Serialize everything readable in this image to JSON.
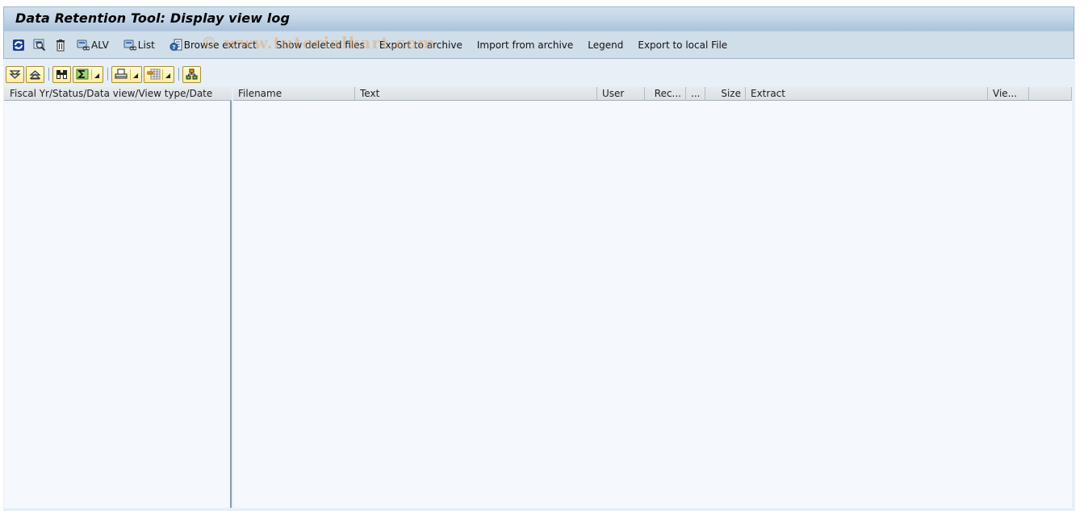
{
  "window": {
    "title": "Data Retention Tool: Display view log"
  },
  "app_toolbar": {
    "items": [
      {
        "id": "refresh",
        "icon": "refresh-icon",
        "label": ""
      },
      {
        "id": "display",
        "icon": "display-zoom-icon",
        "label": ""
      },
      {
        "id": "delete",
        "icon": "trash-icon",
        "label": ""
      },
      {
        "id": "alv",
        "icon": "database-view-icon",
        "label": "ALV"
      },
      {
        "id": "list",
        "icon": "database-view-icon",
        "label": "List"
      },
      {
        "id": "browse",
        "icon": "browse-extract-icon",
        "label": "Browse extract"
      },
      {
        "id": "show_deleted",
        "icon": "",
        "label": "Show deleted files"
      },
      {
        "id": "export_archive",
        "icon": "",
        "label": "Export to archive"
      },
      {
        "id": "import_archive",
        "icon": "",
        "label": "Import from archive"
      },
      {
        "id": "legend",
        "icon": "",
        "label": "Legend"
      },
      {
        "id": "export_local",
        "icon": "",
        "label": "Export to local File"
      }
    ]
  },
  "watermark": "© www.tutorialkart.com",
  "alv_toolbar": {
    "buttons": [
      {
        "id": "expand",
        "icon": "expand-all-icon"
      },
      {
        "id": "collapse",
        "icon": "collapse-all-icon"
      },
      {
        "id": "find",
        "icon": "binoculars-icon"
      },
      {
        "id": "sum",
        "icon": "sum-icon",
        "menu": true
      },
      {
        "id": "print",
        "icon": "print-icon",
        "menu": true
      },
      {
        "id": "layout",
        "icon": "layout-icon",
        "menu": true
      },
      {
        "id": "hierarchy",
        "icon": "hierarchy-icon"
      }
    ]
  },
  "tree": {
    "header": "Fiscal Yr/Status/Data view/View type/Date",
    "rows": []
  },
  "list": {
    "columns": [
      {
        "label": "Filename",
        "align": "left"
      },
      {
        "label": "Text",
        "align": "left"
      },
      {
        "label": "User",
        "align": "left"
      },
      {
        "label": "Rec...",
        "align": "right"
      },
      {
        "label": "...",
        "align": "left"
      },
      {
        "label": "Size",
        "align": "right"
      },
      {
        "label": "Extract",
        "align": "left"
      },
      {
        "label": "Vie...",
        "align": "left"
      },
      {
        "label": "",
        "align": "left"
      }
    ],
    "rows": []
  },
  "colors": {
    "title_gradient_top": "#d2e0ee",
    "title_gradient_bottom": "#a9c2db",
    "toolbar_bg": "#d0deea",
    "content_bg": "#f5f9fd",
    "alv_button_bg": "#fbeea0"
  }
}
